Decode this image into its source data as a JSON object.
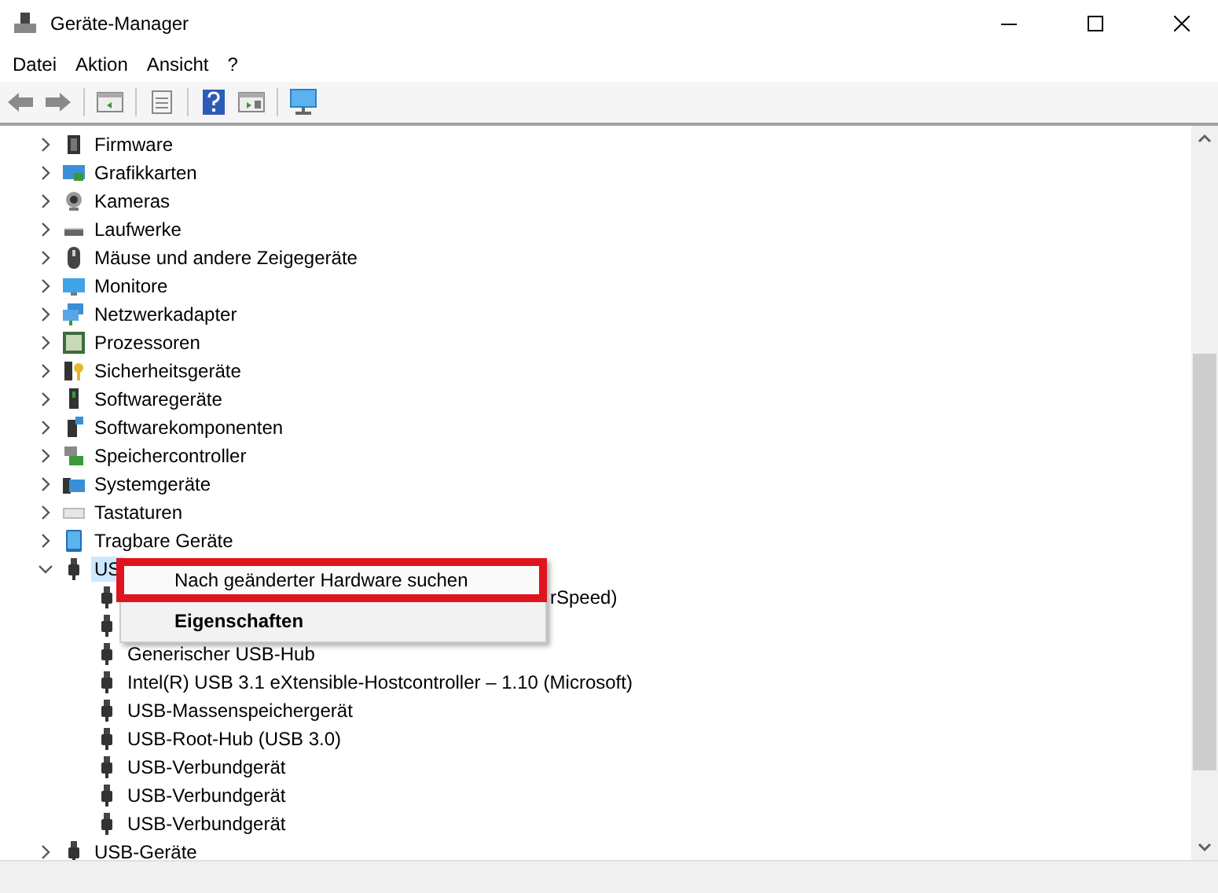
{
  "window": {
    "title": "Geräte-Manager"
  },
  "menu": [
    "Datei",
    "Aktion",
    "Ansicht",
    "?"
  ],
  "tree": {
    "items": [
      {
        "label": "Firmware",
        "expanded": false,
        "selected": false
      },
      {
        "label": "Grafikkarten",
        "expanded": false,
        "selected": false
      },
      {
        "label": "Kameras",
        "expanded": false,
        "selected": false
      },
      {
        "label": "Laufwerke",
        "expanded": false,
        "selected": false
      },
      {
        "label": "Mäuse und andere Zeigegeräte",
        "expanded": false,
        "selected": false
      },
      {
        "label": "Monitore",
        "expanded": false,
        "selected": false
      },
      {
        "label": "Netzwerkadapter",
        "expanded": false,
        "selected": false
      },
      {
        "label": "Prozessoren",
        "expanded": false,
        "selected": false
      },
      {
        "label": "Sicherheitsgeräte",
        "expanded": false,
        "selected": false
      },
      {
        "label": "Softwaregeräte",
        "expanded": false,
        "selected": false
      },
      {
        "label": "Softwarekomponenten",
        "expanded": false,
        "selected": false
      },
      {
        "label": "Speichercontroller",
        "expanded": false,
        "selected": false
      },
      {
        "label": "Systemgeräte",
        "expanded": false,
        "selected": false
      },
      {
        "label": "Tastaturen",
        "expanded": false,
        "selected": false
      },
      {
        "label": "Tragbare Geräte",
        "expanded": false,
        "selected": false
      },
      {
        "label": "US",
        "expanded": true,
        "selected": true,
        "children": [
          {
            "kind": "clipped",
            "label": "rSpeed)"
          },
          {
            "kind": "icon-only"
          },
          {
            "kind": "full",
            "label": "Generischer USB-Hub"
          },
          {
            "kind": "full",
            "label": "Intel(R) USB 3.1 eXtensible-Hostcontroller – 1.10 (Microsoft)"
          },
          {
            "kind": "full",
            "label": "USB-Massenspeichergerät"
          },
          {
            "kind": "full",
            "label": "USB-Root-Hub (USB 3.0)"
          },
          {
            "kind": "full",
            "label": "USB-Verbundgerät"
          },
          {
            "kind": "full",
            "label": "USB-Verbundgerät"
          },
          {
            "kind": "full",
            "label": "USB-Verbundgerät"
          }
        ]
      },
      {
        "label": "USB-Geräte",
        "expanded": false,
        "selected": false
      }
    ]
  },
  "context_menu": {
    "items": [
      {
        "label": "Nach geänderter Hardware suchen",
        "bold": false,
        "highlighted": true
      },
      {
        "label": "Eigenschaften",
        "bold": true,
        "highlighted": false
      }
    ]
  }
}
